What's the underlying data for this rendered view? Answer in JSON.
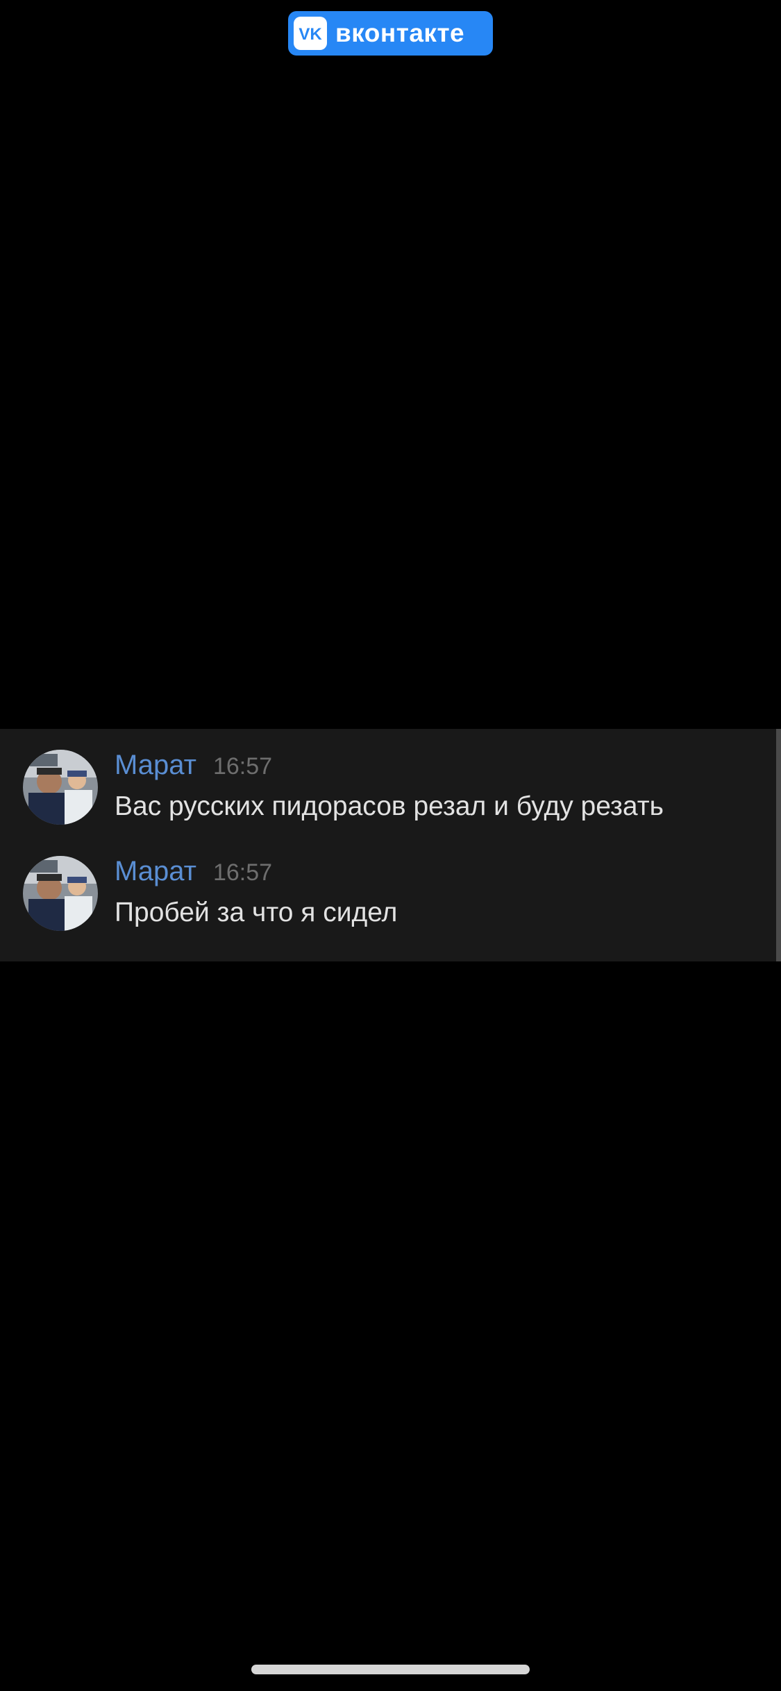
{
  "app": {
    "brand": "вконтакте",
    "logo_icon": "vk-logo-icon",
    "accent_color": "#2787f5"
  },
  "messages": [
    {
      "author": "Марат",
      "time": "16:57",
      "text": "Вас русских пидорасов резал и буду резать",
      "avatar_icon": "user-avatar"
    },
    {
      "author": "Марат",
      "time": "16:57",
      "text": "Пробей за что я сидел",
      "avatar_icon": "user-avatar"
    }
  ],
  "colors": {
    "author_name": "#5a8ed3",
    "timestamp": "#6e6e6e",
    "message_text": "#e2e2e2",
    "chat_background": "#191919"
  }
}
